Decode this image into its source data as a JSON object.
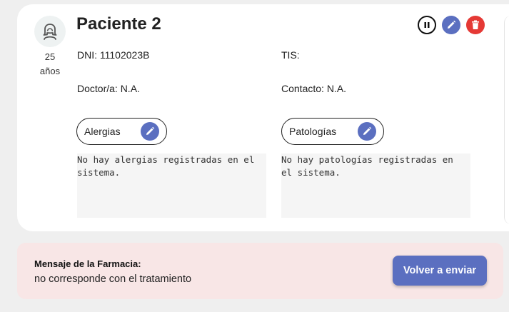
{
  "patient": {
    "name": "Paciente 2",
    "age": "25",
    "age_unit": "años",
    "dni": "DNI: 11102023B",
    "tis": "TIS:",
    "doctor": "Doctor/a: N.A.",
    "contact": "Contacto: N.A."
  },
  "allergies": {
    "label": "Alergias",
    "text": "No hay alergias registradas en el sistema."
  },
  "pathologies": {
    "label": "Patologías",
    "text": "No hay patologías registradas en el sistema."
  },
  "pharmacy_message": {
    "title": "Mensaje de la Farmacia:",
    "text": "no corresponde con el tratamiento",
    "button": "Volver a enviar"
  },
  "icons": {
    "avatar": "person-avatar-icon",
    "pause": "pause-icon",
    "edit": "pencil-icon",
    "delete": "trash-icon"
  },
  "colors": {
    "accent": "#5b6fc0",
    "danger": "#e53935",
    "message_bg": "#f8e6e6"
  }
}
